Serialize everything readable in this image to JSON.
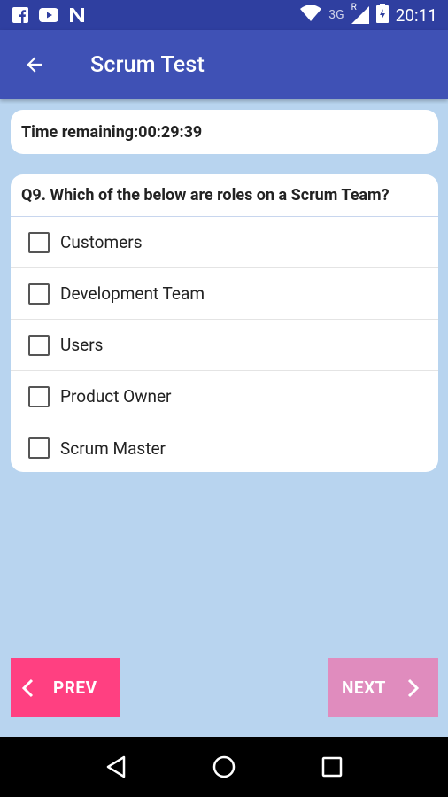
{
  "status_bar": {
    "icons_left": [
      "facebook-icon",
      "youtube-icon",
      "n-app-icon"
    ],
    "network": "3G",
    "roaming": "R",
    "time": "20:11"
  },
  "app_bar": {
    "title": "Scrum Test"
  },
  "timer": {
    "text": "Time remaining:00:29:39"
  },
  "question": {
    "text": "Q9. Which of the below are roles on a Scrum Team?",
    "options": [
      {
        "label": "Customers",
        "checked": false
      },
      {
        "label": "Development Team",
        "checked": false
      },
      {
        "label": "Users",
        "checked": false
      },
      {
        "label": "Product Owner",
        "checked": false
      },
      {
        "label": "Scrum Master",
        "checked": false
      }
    ]
  },
  "buttons": {
    "prev": "PREV",
    "next": "NEXT"
  },
  "colors": {
    "status_bar": "#2f3fa0",
    "app_bar": "#3f51b5",
    "background": "#b8d4ef",
    "prev_button": "#ff4081",
    "next_button": "#e08cbe"
  }
}
